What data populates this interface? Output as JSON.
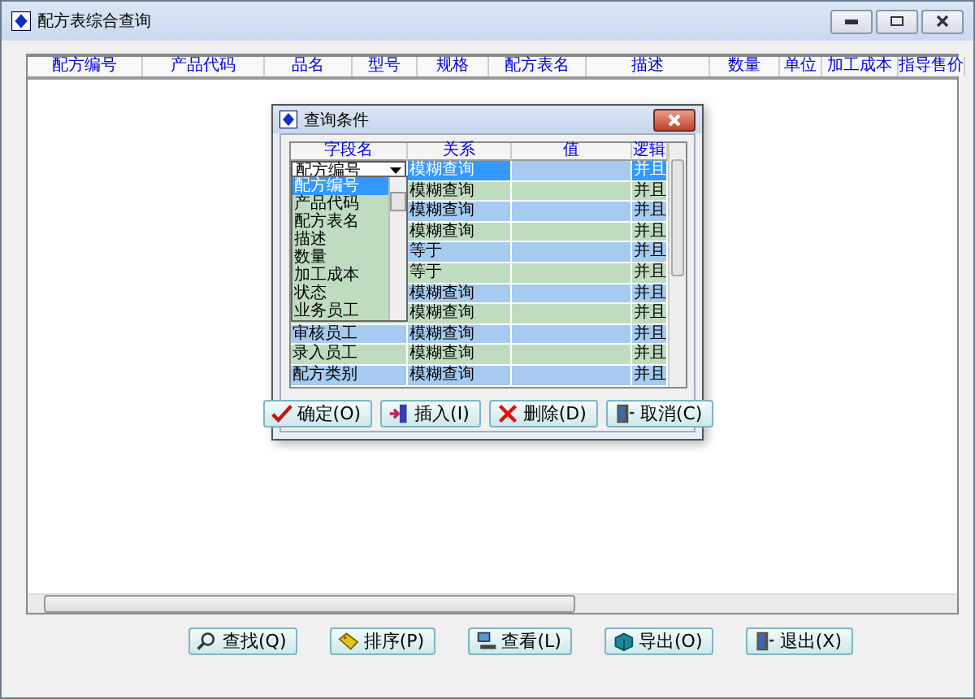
{
  "window": {
    "title": "配方表综合查询"
  },
  "table": {
    "columns": [
      "配方编号",
      "产品代码",
      "品名",
      "型号",
      "规格",
      "配方表名",
      "描述",
      "数量",
      "单位",
      "加工成本",
      "指导售价"
    ]
  },
  "buttons": [
    {
      "label": "查找(Q)",
      "kind": "find"
    },
    {
      "label": "排序(P)",
      "kind": "sort"
    },
    {
      "label": "查看(L)",
      "kind": "view"
    },
    {
      "label": "导出(O)",
      "kind": "export"
    },
    {
      "label": "退出(X)",
      "kind": "exit"
    }
  ],
  "dialog": {
    "title": "查询条件",
    "columns": [
      "字段名",
      "关系",
      "值",
      "逻辑"
    ],
    "rows": [
      {
        "field": "配方编号",
        "relation": "模糊查询",
        "logic": "并且",
        "selected": true
      },
      {
        "relation": "模糊查询",
        "logic": "并且",
        "selected": false
      },
      {
        "relation": "模糊查询",
        "logic": "并且",
        "selected": false
      },
      {
        "relation": "模糊查询",
        "logic": "并且",
        "selected": false
      },
      {
        "relation": "等于",
        "logic": "并且",
        "selected": false
      },
      {
        "relation": "等于",
        "logic": "并且",
        "selected": false
      },
      {
        "relation": "模糊查询",
        "logic": "并且",
        "selected": false
      },
      {
        "relation": "模糊查询",
        "logic": "并且",
        "selected": false
      },
      {
        "field": "审核员工",
        "relation": "模糊查询",
        "logic": "并且",
        "selected": false
      },
      {
        "field": "录入员工",
        "relation": "模糊查询",
        "logic": "并且",
        "selected": false
      },
      {
        "field": "配方类别",
        "relation": "模糊查询",
        "logic": "并且",
        "selected": false
      }
    ],
    "dropdown": {
      "items": [
        {
          "label": "配方编号",
          "selected": true
        },
        {
          "label": "产品代码",
          "selected": false
        },
        {
          "label": "配方表名",
          "selected": false
        },
        {
          "label": "描述",
          "selected": false
        },
        {
          "label": "数量",
          "selected": false
        },
        {
          "label": "加工成本",
          "selected": false
        },
        {
          "label": "状态",
          "selected": false
        },
        {
          "label": "业务员工",
          "selected": false
        }
      ]
    },
    "buttons": [
      {
        "label": "确定(O)",
        "kind": "ok"
      },
      {
        "label": "插入(I)",
        "kind": "insert"
      },
      {
        "label": "删除(D)",
        "kind": "delete"
      },
      {
        "label": "取消(C)",
        "kind": "cancel"
      }
    ]
  }
}
